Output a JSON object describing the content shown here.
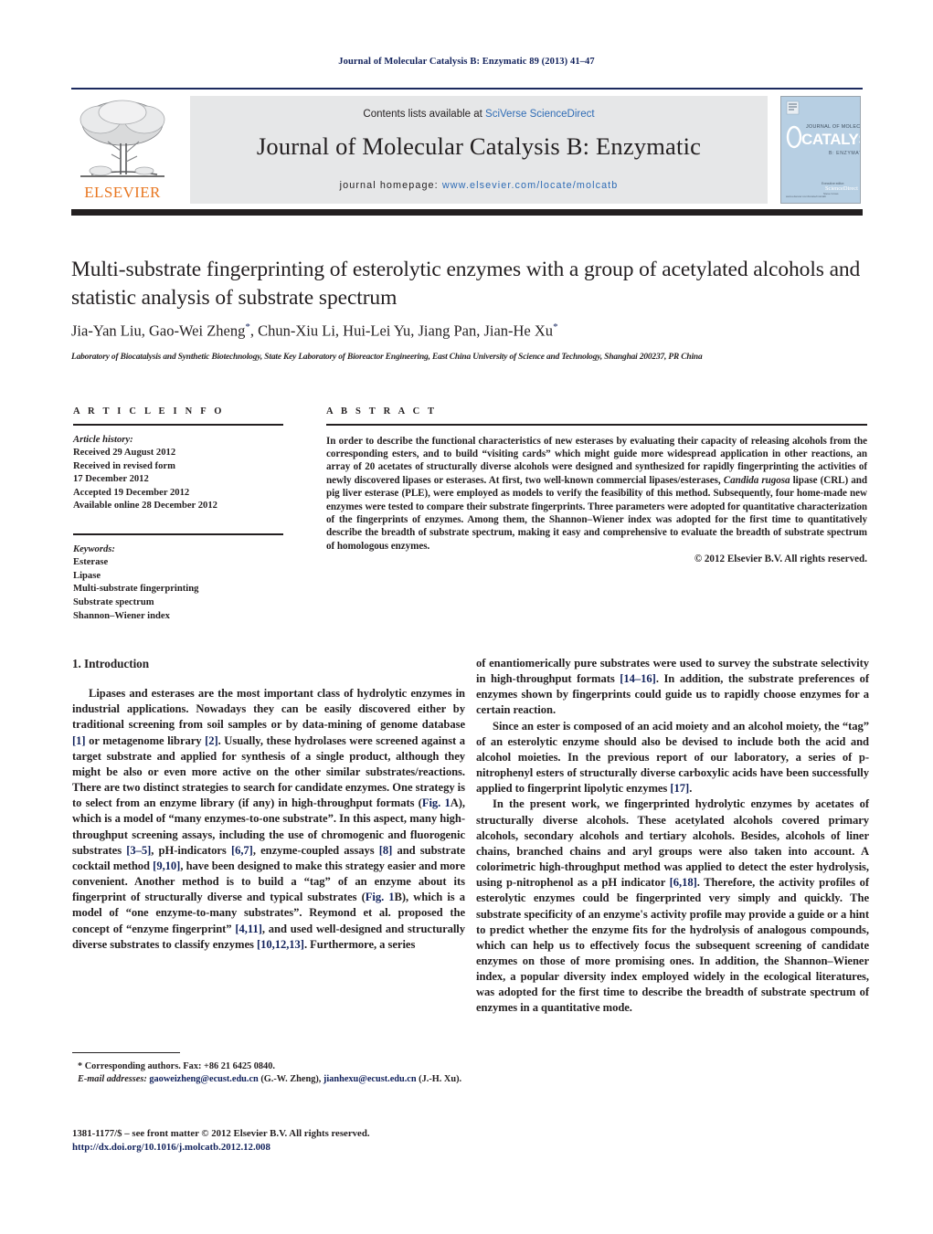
{
  "running_head": "Journal of Molecular Catalysis B: Enzymatic 89 (2013) 41–47",
  "masthead": {
    "contents_prefix": "Contents lists available at ",
    "sciencedirect": "SciVerse ScienceDirect",
    "journal_name": "Journal of Molecular Catalysis B: Enzymatic",
    "homepage_prefix": "journal homepage: ",
    "homepage_url": "www.elsevier.com/locate/molcatb",
    "publisher": "ELSEVIER",
    "cover_title_small": "JOURNAL OF MOLECULAR",
    "cover_title_big": "CATALYSIS",
    "cover_subtitle": "B: ENZYMATIC",
    "cover_footer_label": "Executive editor:",
    "cover_footer_name": "Steve Gross",
    "cover_footer_url": "www.elsevier.com/locate/molcatb",
    "cover_brand": "ScienceDirect"
  },
  "article": {
    "title": "Multi-substrate fingerprinting of esterolytic enzymes with a group of acetylated alcohols and statistic analysis of substrate spectrum",
    "authors": "Jia-Yan Liu, Gao-Wei Zheng",
    "authors_part2": ", Chun-Xiu Li, Hui-Lei Yu, Jiang Pan, Jian-He Xu",
    "star": "*",
    "affiliation": "Laboratory of Biocatalysis and Synthetic Biotechnology, State Key Laboratory of Bioreactor Engineering, East China University of Science and Technology, Shanghai 200237, PR China"
  },
  "info": {
    "heading": "A R T I C L E    I N F O",
    "history_label": "Article history:",
    "history": [
      "Received 29 August 2012",
      "Received in revised form",
      "17 December 2012",
      "Accepted 19 December 2012",
      "Available online 28 December 2012"
    ],
    "keywords_label": "Keywords:",
    "keywords": [
      "Esterase",
      "Lipase",
      "Multi-substrate fingerprinting",
      "Substrate spectrum",
      "Shannon–Wiener index"
    ]
  },
  "abstract": {
    "heading": "A B S T R A C T",
    "part1": "In order to describe the functional characteristics of new esterases by evaluating their capacity of releasing alcohols from the corresponding esters, and to build “visiting cards” which might guide more widespread application in other reactions, an array of 20 acetates of structurally diverse alcohols were designed and synthesized for rapidly fingerprinting the activities of newly discovered lipases or esterases. At first, two well-known commercial lipases/esterases, ",
    "italic1": "Candida rugosa",
    "part2": " lipase (CRL) and pig liver esterase (PLE), were employed as models to verify the feasibility of this method. Subsequently, four home-made new enzymes were tested to compare their substrate fingerprints. Three parameters were adopted for quantitative characterization of the fingerprints of enzymes. Among them, the Shannon–Wiener index was adopted for the first time to quantitatively describe the breadth of substrate spectrum, making it easy and comprehensive to evaluate the breadth of substrate spectrum of homologous enzymes.",
    "copyright": "© 2012 Elsevier B.V. All rights reserved."
  },
  "body": {
    "section1_heading": "1.  Introduction",
    "left_p1_a": "Lipases and esterases are the most important class of hydrolytic enzymes in industrial applications. Nowadays they can be easily discovered either by traditional screening from soil samples or by data-mining of genome database ",
    "ref1": "[1]",
    "left_p1_b": " or metagenome library ",
    "ref2": "[2]",
    "left_p1_c": ". Usually, these hydrolases were screened against a target substrate and applied for synthesis of a single product, although they might be also or even more active on the other similar substrates/reactions. There are two distinct strategies to search for candidate enzymes. One strategy is to select from an enzyme library (if any) in high-throughput formats (",
    "ref_fig1a": "Fig. 1",
    "left_p1_d": "A), which is a model of “many enzymes-to-one substrate”. In this aspect, many high-throughput screening assays, including the use of chromogenic and fluorogenic substrates ",
    "ref3_5": "[3–5]",
    "left_p1_e": ", pH-indicators ",
    "ref6_7": "[6,7]",
    "left_p1_f": ", enzyme-coupled assays ",
    "ref8": "[8]",
    "left_p1_g": " and substrate cocktail method ",
    "ref9_10": "[9,10]",
    "left_p1_h": ", have been designed to make this strategy easier and more convenient. Another method is to build a “tag” of an enzyme about its fingerprint of structurally diverse and typical substrates (",
    "ref_fig1b": "Fig. 1",
    "left_p1_i": "B), which is a model of “one enzyme-to-many substrates”. Reymond et al. proposed the concept of “enzyme fingerprint” ",
    "ref4_11": "[4,11]",
    "left_p1_j": ", and used well-designed and structurally diverse substrates to classify enzymes ",
    "ref10_12_13": "[10,12,13]",
    "left_p1_k": ". Furthermore, a series",
    "right_p1_a": "of enantiomerically pure substrates were used to survey the substrate selectivity in high-throughput formats ",
    "ref14_16": "[14–16]",
    "right_p1_b": ". In addition, the substrate preferences of enzymes shown by fingerprints could guide us to rapidly choose enzymes for a certain reaction.",
    "right_p2_a": "Since an ester is composed of an acid moiety and an alcohol moiety, the “tag” of an esterolytic enzyme should also be devised to include both the acid and alcohol moieties. In the previous report of our laboratory, a series of p-nitrophenyl esters of structurally diverse carboxylic acids have been successfully applied to fingerprint lipolytic enzymes ",
    "ref17": "[17]",
    "right_p2_b": ".",
    "right_p3_a": "In the present work, we fingerprinted hydrolytic enzymes by acetates of structurally diverse alcohols. These acetylated alcohols covered primary alcohols, secondary alcohols and tertiary alcohols. Besides, alcohols of liner chains, branched chains and aryl groups were also taken into account. A colorimetric high-throughput method was applied to detect the ester hydrolysis, using p-nitrophenol as a pH indicator ",
    "ref6_18": "[6,18]",
    "right_p3_b": ". Therefore, the activity profiles of esterolytic enzymes could be fingerprinted very simply and quickly. The substrate specificity of an enzyme's activity profile may provide a guide or a hint to predict whether the enzyme fits for the hydrolysis of analogous compounds, which can help us to effectively focus the subsequent screening of candidate enzymes on those of more promising ones. In addition, the Shannon–Wiener index, a popular diversity index employed widely in the ecological literatures, was adopted for the first time to describe the breadth of substrate spectrum of enzymes in a quantitative mode."
  },
  "footnotes": {
    "corresponding": "* Corresponding authors. Fax: +86 21 6425 0840.",
    "email_label": "E-mail addresses:",
    "email1": "gaoweizheng@ecust.edu.cn",
    "email1_owner": " (G.-W. Zheng),",
    "email2": "jianhexu@ecust.edu.cn",
    "email2_owner": " (J.-H. Xu).",
    "imprint": "1381-1177/$ – see front matter © 2012 Elsevier B.V. All rights reserved.",
    "doi": "http://dx.doi.org/10.1016/j.molcatb.2012.12.008"
  },
  "colors": {
    "link_blue": "#12225c",
    "sd_blue": "#2f6cb5",
    "elsevier_orange": "#e87722",
    "rule_navy": "#1c2a5e",
    "rule_black": "#231f20",
    "header_gray": "#e6e7e8",
    "cover_blue": "#b7cfe3"
  }
}
